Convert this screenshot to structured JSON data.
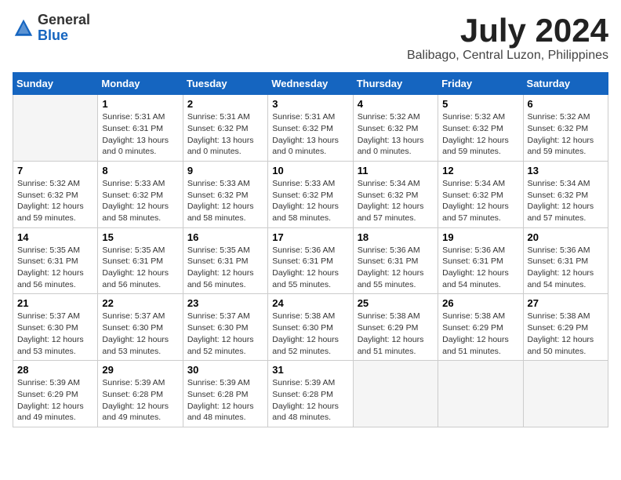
{
  "header": {
    "logo_general": "General",
    "logo_blue": "Blue",
    "month_title": "July 2024",
    "location": "Balibago, Central Luzon, Philippines"
  },
  "days_of_week": [
    "Sunday",
    "Monday",
    "Tuesday",
    "Wednesday",
    "Thursday",
    "Friday",
    "Saturday"
  ],
  "weeks": [
    [
      {
        "day": "",
        "info": ""
      },
      {
        "day": "1",
        "info": "Sunrise: 5:31 AM\nSunset: 6:31 PM\nDaylight: 13 hours\nand 0 minutes."
      },
      {
        "day": "2",
        "info": "Sunrise: 5:31 AM\nSunset: 6:32 PM\nDaylight: 13 hours\nand 0 minutes."
      },
      {
        "day": "3",
        "info": "Sunrise: 5:31 AM\nSunset: 6:32 PM\nDaylight: 13 hours\nand 0 minutes."
      },
      {
        "day": "4",
        "info": "Sunrise: 5:32 AM\nSunset: 6:32 PM\nDaylight: 13 hours\nand 0 minutes."
      },
      {
        "day": "5",
        "info": "Sunrise: 5:32 AM\nSunset: 6:32 PM\nDaylight: 12 hours\nand 59 minutes."
      },
      {
        "day": "6",
        "info": "Sunrise: 5:32 AM\nSunset: 6:32 PM\nDaylight: 12 hours\nand 59 minutes."
      }
    ],
    [
      {
        "day": "7",
        "info": "Sunrise: 5:32 AM\nSunset: 6:32 PM\nDaylight: 12 hours\nand 59 minutes."
      },
      {
        "day": "8",
        "info": "Sunrise: 5:33 AM\nSunset: 6:32 PM\nDaylight: 12 hours\nand 58 minutes."
      },
      {
        "day": "9",
        "info": "Sunrise: 5:33 AM\nSunset: 6:32 PM\nDaylight: 12 hours\nand 58 minutes."
      },
      {
        "day": "10",
        "info": "Sunrise: 5:33 AM\nSunset: 6:32 PM\nDaylight: 12 hours\nand 58 minutes."
      },
      {
        "day": "11",
        "info": "Sunrise: 5:34 AM\nSunset: 6:32 PM\nDaylight: 12 hours\nand 57 minutes."
      },
      {
        "day": "12",
        "info": "Sunrise: 5:34 AM\nSunset: 6:32 PM\nDaylight: 12 hours\nand 57 minutes."
      },
      {
        "day": "13",
        "info": "Sunrise: 5:34 AM\nSunset: 6:32 PM\nDaylight: 12 hours\nand 57 minutes."
      }
    ],
    [
      {
        "day": "14",
        "info": "Sunrise: 5:35 AM\nSunset: 6:31 PM\nDaylight: 12 hours\nand 56 minutes."
      },
      {
        "day": "15",
        "info": "Sunrise: 5:35 AM\nSunset: 6:31 PM\nDaylight: 12 hours\nand 56 minutes."
      },
      {
        "day": "16",
        "info": "Sunrise: 5:35 AM\nSunset: 6:31 PM\nDaylight: 12 hours\nand 56 minutes."
      },
      {
        "day": "17",
        "info": "Sunrise: 5:36 AM\nSunset: 6:31 PM\nDaylight: 12 hours\nand 55 minutes."
      },
      {
        "day": "18",
        "info": "Sunrise: 5:36 AM\nSunset: 6:31 PM\nDaylight: 12 hours\nand 55 minutes."
      },
      {
        "day": "19",
        "info": "Sunrise: 5:36 AM\nSunset: 6:31 PM\nDaylight: 12 hours\nand 54 minutes."
      },
      {
        "day": "20",
        "info": "Sunrise: 5:36 AM\nSunset: 6:31 PM\nDaylight: 12 hours\nand 54 minutes."
      }
    ],
    [
      {
        "day": "21",
        "info": "Sunrise: 5:37 AM\nSunset: 6:30 PM\nDaylight: 12 hours\nand 53 minutes."
      },
      {
        "day": "22",
        "info": "Sunrise: 5:37 AM\nSunset: 6:30 PM\nDaylight: 12 hours\nand 53 minutes."
      },
      {
        "day": "23",
        "info": "Sunrise: 5:37 AM\nSunset: 6:30 PM\nDaylight: 12 hours\nand 52 minutes."
      },
      {
        "day": "24",
        "info": "Sunrise: 5:38 AM\nSunset: 6:30 PM\nDaylight: 12 hours\nand 52 minutes."
      },
      {
        "day": "25",
        "info": "Sunrise: 5:38 AM\nSunset: 6:29 PM\nDaylight: 12 hours\nand 51 minutes."
      },
      {
        "day": "26",
        "info": "Sunrise: 5:38 AM\nSunset: 6:29 PM\nDaylight: 12 hours\nand 51 minutes."
      },
      {
        "day": "27",
        "info": "Sunrise: 5:38 AM\nSunset: 6:29 PM\nDaylight: 12 hours\nand 50 minutes."
      }
    ],
    [
      {
        "day": "28",
        "info": "Sunrise: 5:39 AM\nSunset: 6:29 PM\nDaylight: 12 hours\nand 49 minutes."
      },
      {
        "day": "29",
        "info": "Sunrise: 5:39 AM\nSunset: 6:28 PM\nDaylight: 12 hours\nand 49 minutes."
      },
      {
        "day": "30",
        "info": "Sunrise: 5:39 AM\nSunset: 6:28 PM\nDaylight: 12 hours\nand 48 minutes."
      },
      {
        "day": "31",
        "info": "Sunrise: 5:39 AM\nSunset: 6:28 PM\nDaylight: 12 hours\nand 48 minutes."
      },
      {
        "day": "",
        "info": ""
      },
      {
        "day": "",
        "info": ""
      },
      {
        "day": "",
        "info": ""
      }
    ]
  ]
}
